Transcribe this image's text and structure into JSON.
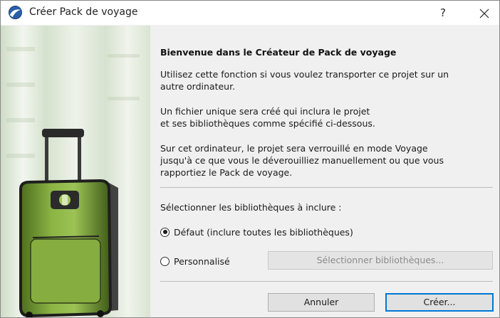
{
  "window": {
    "title": "Créer Pack de voyage",
    "help_label": "?",
    "close_label": "✕"
  },
  "content": {
    "heading": "Bienvenue dans le Créateur de Pack de voyage",
    "para1_line1": "Utilisez cette fonction si vous voulez transporter ce projet sur un",
    "para1_line2": "autre ordinateur.",
    "para2_line1": "Un fichier unique sera créé qui inclura le projet",
    "para2_line2": "et ses bibliothèques comme spécifié ci-dessous.",
    "para3_line1": "Sur cet ordinateur, le projet sera verrouillé en mode Voyage",
    "para3_line2": "jusqu'à ce que vous le déverouilliez manuellement ou que vous",
    "para3_line3": "rapportiez le Pack de voyage.",
    "select_label": "Sélectionner les bibliothèques à inclure :",
    "option_default": "Défaut (inclure toutes les bibliothèques)",
    "option_custom": "Personnalisé",
    "select_libraries_button": "Sélectionner bibliothèques...",
    "selected_option": "default"
  },
  "buttons": {
    "cancel": "Annuler",
    "create": "Créer..."
  },
  "colors": {
    "accent": "#0078d7",
    "suitcase_green": "#7fa83a"
  },
  "icons": {
    "app": "archicad-icon",
    "close": "close-icon",
    "illustration": "green-suitcase-illustration"
  }
}
